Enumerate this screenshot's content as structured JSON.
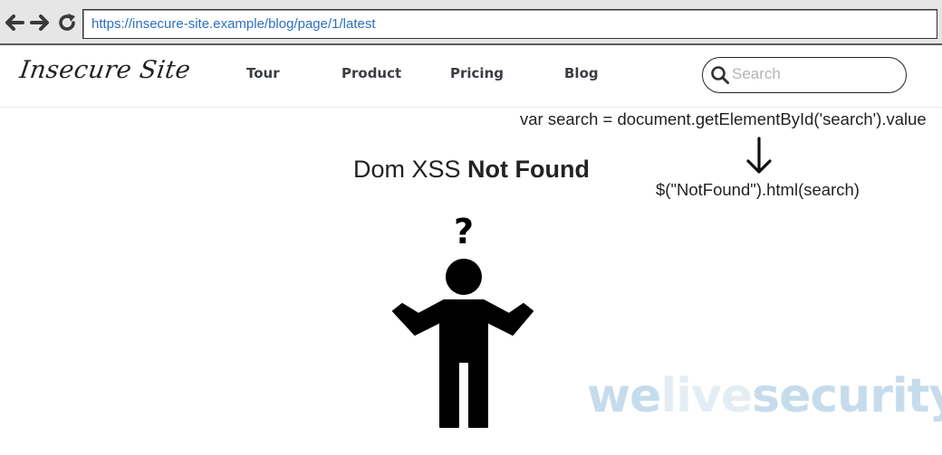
{
  "browser": {
    "url": "https://insecure-site.example/blog/page/1/latest",
    "icons": [
      "back-arrow-icon",
      "forward-arrow-icon",
      "reload-icon"
    ]
  },
  "site": {
    "logo": "Insecure Site",
    "nav": [
      {
        "label": "Tour"
      },
      {
        "label": "Product"
      },
      {
        "label": "Pricing"
      },
      {
        "label": "Blog"
      }
    ],
    "search": {
      "placeholder": "Search",
      "value": "",
      "icon": "search-icon"
    }
  },
  "content": {
    "code_line_1": "var search = document.getElementById('search').value",
    "code_line_2": "$(\"NotFound\").html(search)",
    "title_normal": "Dom XSS ",
    "title_bold": "Not Found",
    "question_mark": "?",
    "figure_icon": "confused-person-icon",
    "arrow_icon": "down-arrow-icon"
  },
  "watermark": {
    "part1": "we",
    "part2": "live",
    "part3": "security"
  },
  "colors": {
    "url_text": "#2e6fbf",
    "chrome_bg": "#e6e6e6",
    "watermark": "#c6dcec"
  }
}
